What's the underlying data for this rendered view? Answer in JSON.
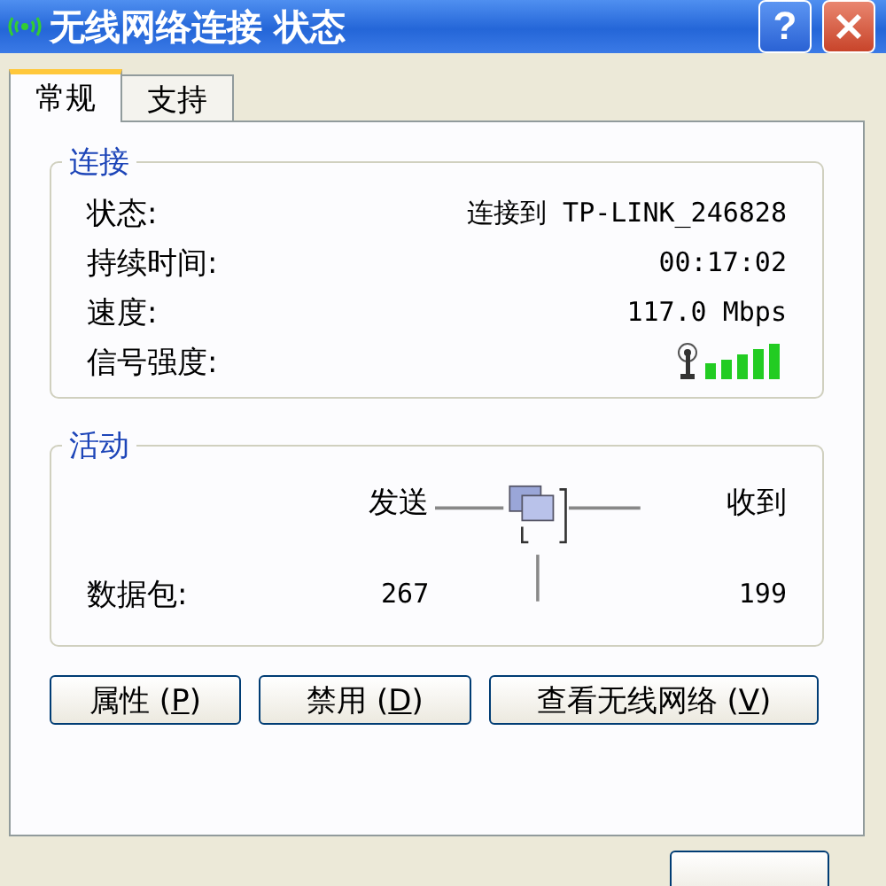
{
  "window": {
    "title": "无线网络连接  状态",
    "help": "?"
  },
  "tabs": [
    {
      "label": "常规",
      "selected": true
    },
    {
      "label": "支持",
      "selected": false
    }
  ],
  "connection": {
    "title": "连接",
    "rows": [
      {
        "kind": "text",
        "label": "状态:",
        "value": "连接到 TP-LINK_246828"
      },
      {
        "kind": "text",
        "label": "持续时间:",
        "value": "00:17:02"
      },
      {
        "kind": "text",
        "label": "速度:",
        "value": "117.0 Mbps"
      },
      {
        "kind": "signal",
        "label": "信号强度:"
      }
    ]
  },
  "activity": {
    "title": "活动",
    "sent_label": "发送",
    "received_label": "收到",
    "rows": [
      {
        "label": "数据包:",
        "sent": "267",
        "received": "199"
      }
    ]
  },
  "buttons": [
    {
      "before": "属性 (",
      "key": "P",
      "after": ")"
    },
    {
      "before": "禁用 (",
      "key": "D",
      "after": ")"
    },
    {
      "before": "查看无线网络 (",
      "key": "V",
      "after": ")"
    }
  ]
}
